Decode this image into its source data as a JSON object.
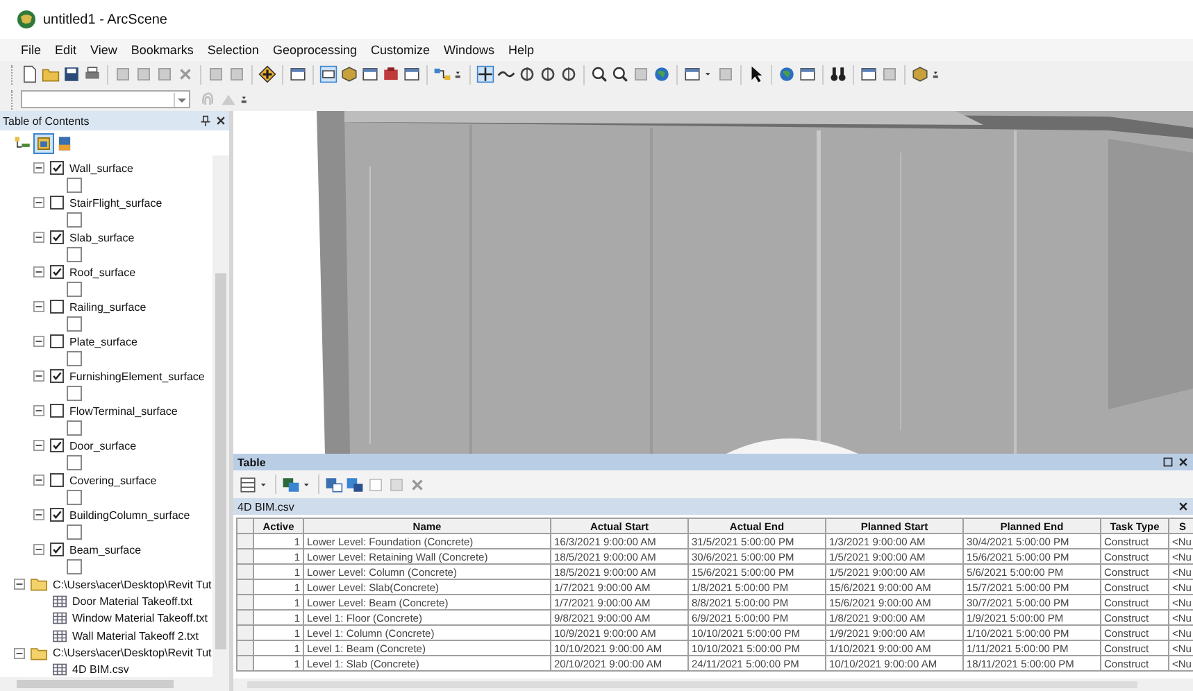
{
  "window": {
    "title": "untitled1 - ArcScene"
  },
  "menu": [
    "File",
    "Edit",
    "View",
    "Bookmarks",
    "Selection",
    "Geoprocessing",
    "Customize",
    "Windows",
    "Help"
  ],
  "toc": {
    "title": "Table of Contents",
    "layers": [
      {
        "name": "Wall_surface",
        "checked": true,
        "expanded": true
      },
      {
        "name": "StairFlight_surface",
        "checked": false,
        "expanded": true
      },
      {
        "name": "Slab_surface",
        "checked": true,
        "expanded": true
      },
      {
        "name": "Roof_surface",
        "checked": true,
        "expanded": true
      },
      {
        "name": "Railing_surface",
        "checked": false,
        "expanded": true
      },
      {
        "name": "Plate_surface",
        "checked": false,
        "expanded": true
      },
      {
        "name": "FurnishingElement_surface",
        "checked": true,
        "expanded": true
      },
      {
        "name": "FlowTerminal_surface",
        "checked": false,
        "expanded": true
      },
      {
        "name": "Door_surface",
        "checked": true,
        "expanded": true
      },
      {
        "name": "Covering_surface",
        "checked": false,
        "expanded": true
      },
      {
        "name": "BuildingColumn_surface",
        "checked": true,
        "expanded": true
      },
      {
        "name": "Beam_surface",
        "checked": true,
        "expanded": true
      }
    ],
    "sources": [
      {
        "path": "C:\\Users\\acer\\Desktop\\Revit Tut",
        "expanded": true,
        "children": [
          {
            "name": "Door Material Takeoff.txt"
          },
          {
            "name": "Window Material Takeoff.txt"
          },
          {
            "name": "Wall Material Takeoff 2.txt"
          }
        ]
      },
      {
        "path": "C:\\Users\\acer\\Desktop\\Revit Tut",
        "expanded": true,
        "children": [
          {
            "name": "4D BIM.csv"
          }
        ]
      }
    ]
  },
  "table": {
    "title": "Table",
    "tab": "4D BIM.csv",
    "columns": [
      "Active",
      "Name",
      "Actual Start",
      "Actual End",
      "Planned Start",
      "Planned End",
      "Task Type",
      "S"
    ],
    "rows": [
      [
        "1",
        "Lower Level: Foundation (Concrete)",
        "16/3/2021 9:00:00 AM",
        "31/5/2021 5:00:00 PM",
        "1/3/2021 9:00:00 AM",
        "30/4/2021 5:00:00 PM",
        "Construct",
        "<Nu"
      ],
      [
        "1",
        "Lower Level: Retaining Wall (Concrete)",
        "18/5/2021 9:00:00 AM",
        "30/6/2021 5:00:00 PM",
        "1/5/2021 9:00:00 AM",
        "15/6/2021 5:00:00 PM",
        "Construct",
        "<Nu"
      ],
      [
        "1",
        "Lower Level: Column (Concrete)",
        "18/5/2021 9:00:00 AM",
        "15/6/2021 5:00:00 PM",
        "1/5/2021 9:00:00 AM",
        "5/6/2021 5:00:00 PM",
        "Construct",
        "<Nu"
      ],
      [
        "1",
        "Lower Level: Slab(Concrete)",
        "1/7/2021 9:00:00 AM",
        "1/8/2021 5:00:00 PM",
        "15/6/2021 9:00:00 AM",
        "15/7/2021 5:00:00 PM",
        "Construct",
        "<Nu"
      ],
      [
        "1",
        "Lower Level: Beam (Concrete)",
        "1/7/2021 9:00:00 AM",
        "8/8/2021 5:00:00 PM",
        "15/6/2021 9:00:00 AM",
        "30/7/2021 5:00:00 PM",
        "Construct",
        "<Nu"
      ],
      [
        "1",
        "Level 1: Floor (Concrete)",
        "9/8/2021 9:00:00 AM",
        "6/9/2021 5:00:00 PM",
        "1/8/2021 9:00:00 AM",
        "1/9/2021 5:00:00 PM",
        "Construct",
        "<Nu"
      ],
      [
        "1",
        "Level 1: Column (Concrete)",
        "10/9/2021 9:00:00 AM",
        "10/10/2021 5:00:00 PM",
        "1/9/2021 9:00:00 AM",
        "1/10/2021 5:00:00 PM",
        "Construct",
        "<Nu"
      ],
      [
        "1",
        "Level 1: Beam (Concrete)",
        "10/10/2021 9:00:00 AM",
        "10/10/2021 5:00:00 PM",
        "1/10/2021 9:00:00 AM",
        "1/11/2021 5:00:00 PM",
        "Construct",
        "<Nu"
      ],
      [
        "1",
        "Level 1: Slab (Concrete)",
        "20/10/2021 9:00:00 AM",
        "24/11/2021 5:00:00 PM",
        "10/10/2021 9:00:00 AM",
        "18/11/2021 5:00:00 PM",
        "Construct",
        "<Nu"
      ]
    ]
  }
}
